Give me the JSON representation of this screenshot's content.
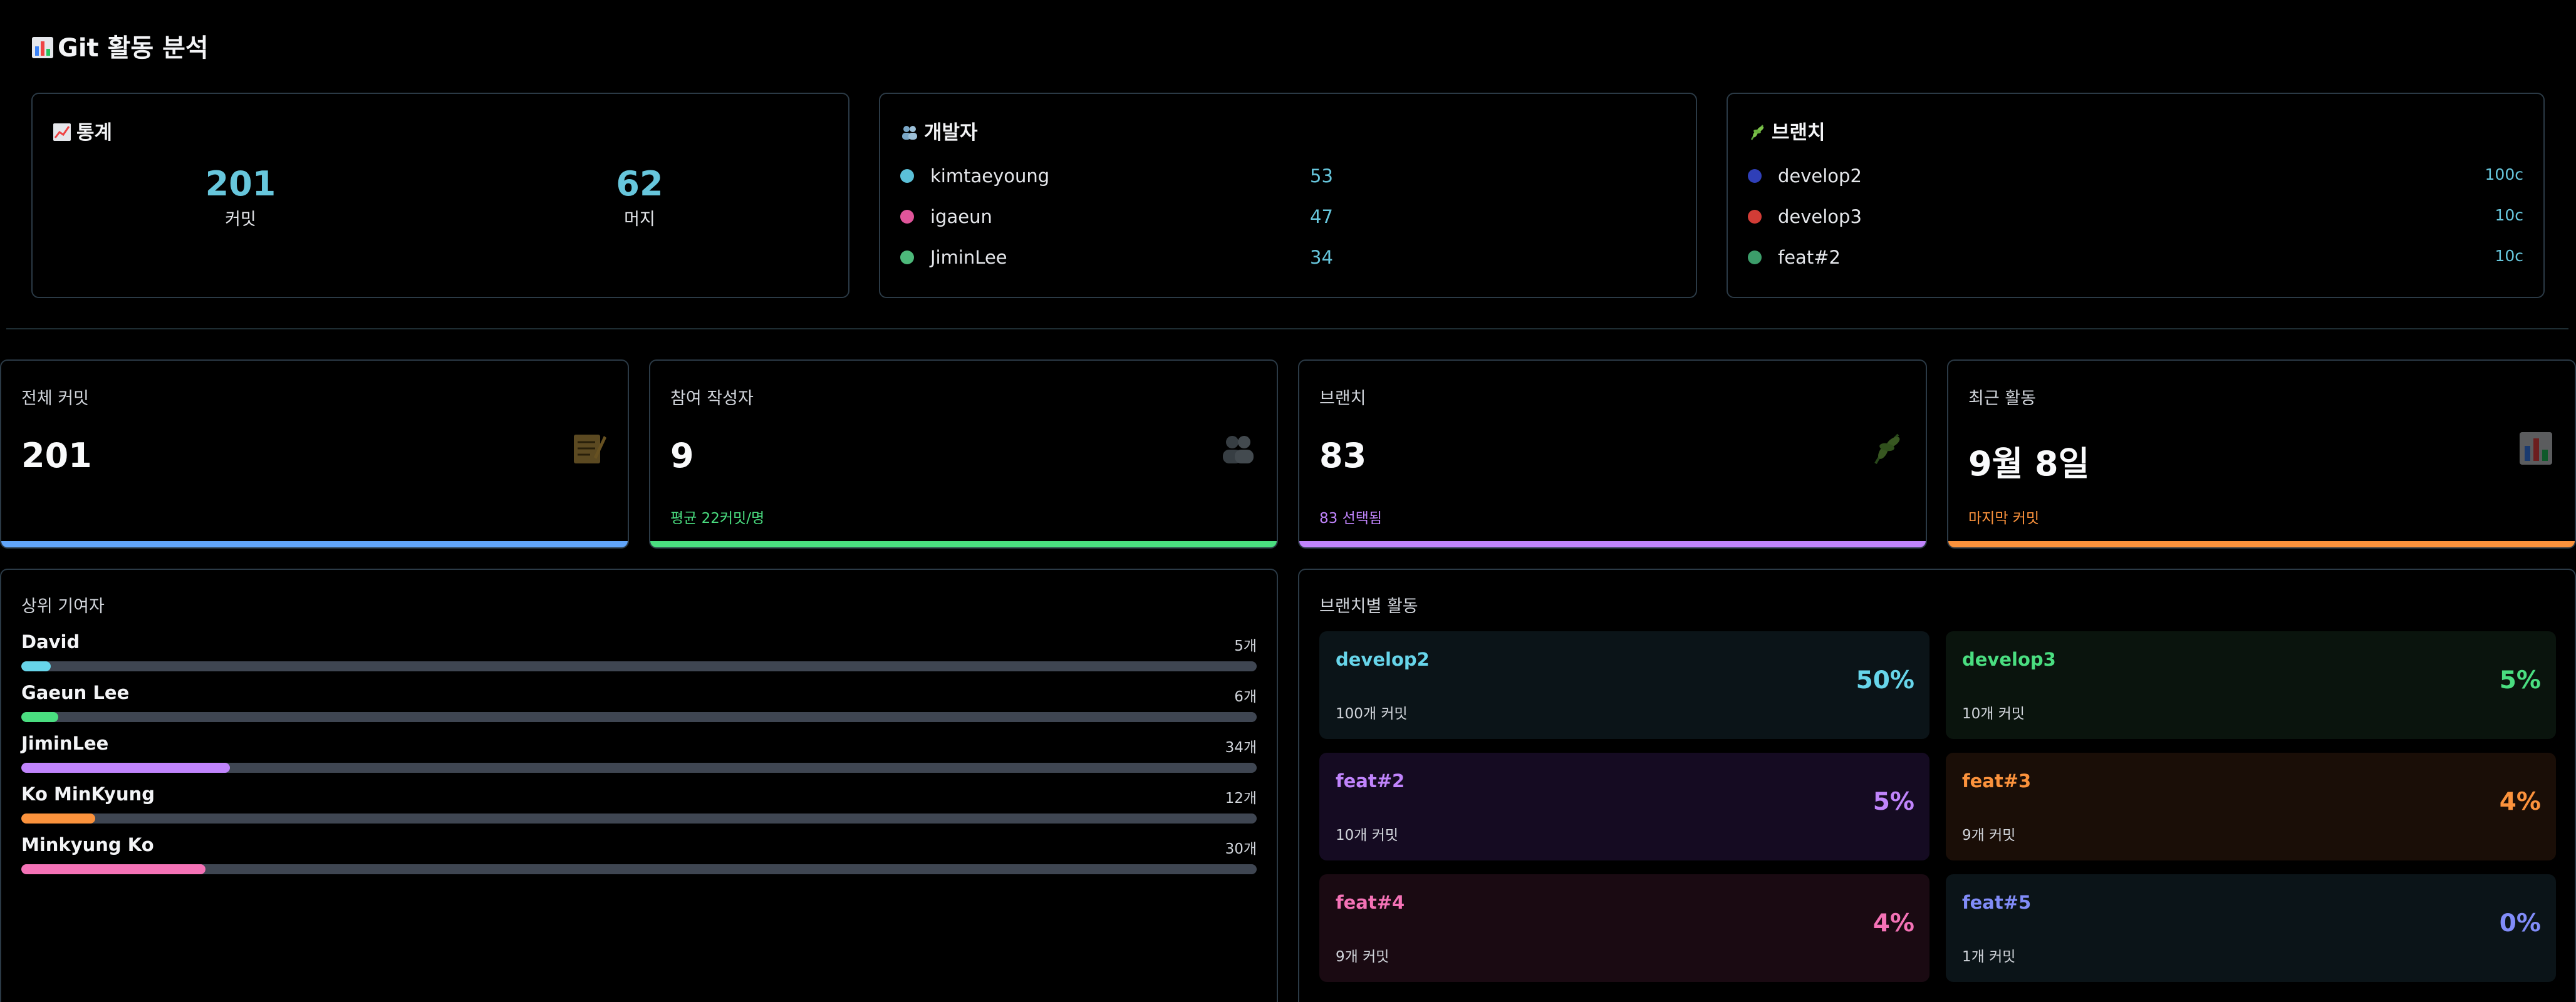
{
  "header": {
    "title": "Git 활동 분석",
    "icon": "bar-chart-icon"
  },
  "stats_card": {
    "title": "통계",
    "icon": "chart-up-icon",
    "items": [
      {
        "value": "201",
        "label": "커밋"
      },
      {
        "value": "62",
        "label": "머지"
      }
    ]
  },
  "devs_card": {
    "title": "개발자",
    "icon": "people-icon",
    "items": [
      {
        "name": "kimtaeyoung",
        "count": "53",
        "color": "#5bc0d8"
      },
      {
        "name": "igaeun",
        "count": "47",
        "color": "#e0559a"
      },
      {
        "name": "JiminLee",
        "count": "34",
        "color": "#4db97a"
      }
    ]
  },
  "branches_card": {
    "title": "브랜치",
    "icon": "herb-icon",
    "items": [
      {
        "name": "develop2",
        "count": "100c",
        "color": "#2f3fb8"
      },
      {
        "name": "develop3",
        "count": "10c",
        "color": "#d23c36"
      },
      {
        "name": "feat#2",
        "count": "10c",
        "color": "#3c9d6a"
      }
    ]
  },
  "metrics": [
    {
      "label": "전체 커밋",
      "value": "201",
      "sub": "",
      "icon": "memo-icon",
      "color": "#60a5fa"
    },
    {
      "label": "참여 작성자",
      "value": "9",
      "sub": "평균 22커밋/명",
      "icon": "people-icon",
      "color": "#4ade80"
    },
    {
      "label": "브랜치",
      "value": "83",
      "sub": "83 선택됨",
      "icon": "herb-icon",
      "color": "#c084fc"
    },
    {
      "label": "최근 활동",
      "value": "9월 8일",
      "sub": "마지막 커밋",
      "icon": "bar-chart-icon",
      "color": "#fb923c"
    }
  ],
  "contributors": {
    "title": "상위 기여자",
    "items": [
      {
        "name": "David",
        "count": "5개",
        "fraction": 0.024,
        "color": "#67d5ea"
      },
      {
        "name": "Gaeun Lee",
        "count": "6개",
        "fraction": 0.03,
        "color": "#4ade80"
      },
      {
        "name": "JiminLee",
        "count": "34개",
        "fraction": 0.169,
        "color": "#c084fc"
      },
      {
        "name": "Ko MinKyung",
        "count": "12개",
        "fraction": 0.06,
        "color": "#fb923c"
      },
      {
        "name": "Minkyung Ko",
        "count": "30개",
        "fraction": 0.149,
        "color": "#f472b6"
      }
    ]
  },
  "branch_activity": {
    "title": "브랜치별 활동",
    "items": [
      {
        "name": "develop2",
        "commits": "100개 커밋",
        "pct": "50%",
        "color": "#67d5ea",
        "bg": "#0b1418"
      },
      {
        "name": "develop3",
        "commits": "10개 커밋",
        "pct": "5%",
        "color": "#4ade80",
        "bg": "#0a140d"
      },
      {
        "name": "feat#2",
        "commits": "10개 커밋",
        "pct": "5%",
        "color": "#c084fc",
        "bg": "#150b22"
      },
      {
        "name": "feat#3",
        "commits": "9개 커밋",
        "pct": "4%",
        "color": "#fb923c",
        "bg": "#1a0e07"
      },
      {
        "name": "feat#4",
        "commits": "9개 커밋",
        "pct": "4%",
        "color": "#f472b6",
        "bg": "#1a0a12"
      },
      {
        "name": "feat#5",
        "commits": "1개 커밋",
        "pct": "0%",
        "color": "#818cf8",
        "bg": "#0b1418"
      }
    ]
  }
}
